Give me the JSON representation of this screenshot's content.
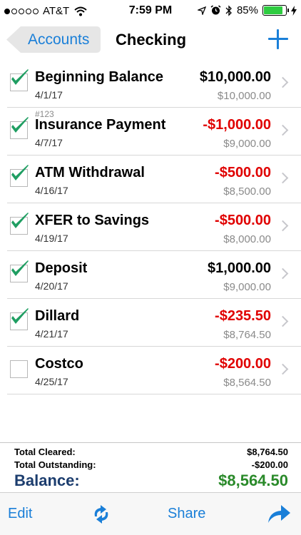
{
  "status_bar": {
    "carrier": "AT&T",
    "time": "7:59 PM",
    "battery": "85%",
    "signal_dots_filled": 1,
    "signal_dots_total": 5,
    "battery_level": 0.85
  },
  "nav": {
    "back_label": "Accounts",
    "title": "Checking",
    "add_icon": "plus-icon"
  },
  "transactions": [
    {
      "number": "",
      "name": "Beginning Balance",
      "date": "4/1/17",
      "amount": "$10,000.00",
      "balance": "$10,000.00",
      "cleared": true,
      "negative": false
    },
    {
      "number": "#123",
      "name": "Insurance Payment",
      "date": "4/7/17",
      "amount": "-$1,000.00",
      "balance": "$9,000.00",
      "cleared": true,
      "negative": true
    },
    {
      "number": "",
      "name": "ATM Withdrawal",
      "date": "4/16/17",
      "amount": "-$500.00",
      "balance": "$8,500.00",
      "cleared": true,
      "negative": true
    },
    {
      "number": "",
      "name": "XFER to Savings",
      "date": "4/19/17",
      "amount": "-$500.00",
      "balance": "$8,000.00",
      "cleared": true,
      "negative": true
    },
    {
      "number": "",
      "name": "Deposit",
      "date": "4/20/17",
      "amount": "$1,000.00",
      "balance": "$9,000.00",
      "cleared": true,
      "negative": false
    },
    {
      "number": "",
      "name": "Dillard",
      "date": "4/21/17",
      "amount": "-$235.50",
      "balance": "$8,764.50",
      "cleared": true,
      "negative": true
    },
    {
      "number": "",
      "name": "Costco",
      "date": "4/25/17",
      "amount": "-$200.00",
      "balance": "$8,564.50",
      "cleared": false,
      "negative": true
    }
  ],
  "summary": {
    "cleared_label": "Total Cleared:",
    "cleared_value": "$8,764.50",
    "outstanding_label": "Total Outstanding:",
    "outstanding_value": "-$200.00",
    "balance_label": "Balance:",
    "balance_value": "$8,564.50"
  },
  "toolbar": {
    "edit_label": "Edit",
    "share_label": "Share",
    "sync_icon": "sync-icon",
    "forward_icon": "forward-arrow-icon"
  },
  "colors": {
    "accent": "#1a7fd8",
    "negative": "#e00000",
    "check": "#1f9e62",
    "balance_positive": "#2a8a2a",
    "balance_label": "#1c3d6e"
  }
}
